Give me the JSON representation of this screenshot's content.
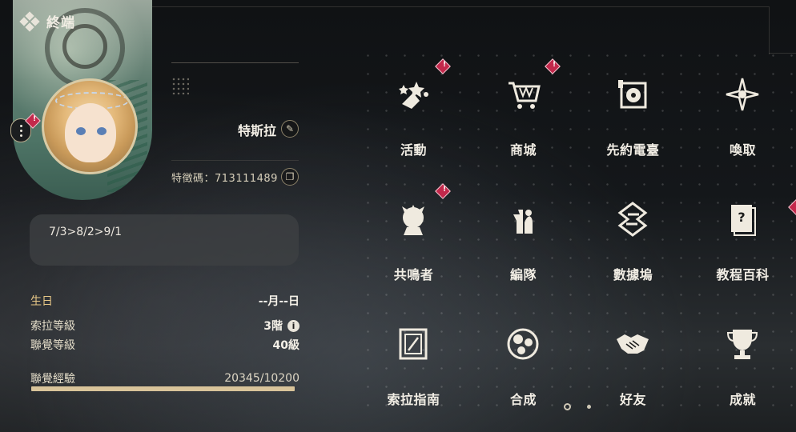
{
  "header": {
    "title": "終端"
  },
  "profile": {
    "name": "特斯拉",
    "uid_label": "特徵碼：",
    "uid": "713111489",
    "signature": "7/3>8/2>9/1"
  },
  "stats": {
    "birthday_label": "生日",
    "birthday_value": "--月--日",
    "sola_level_label": "索拉等級",
    "sola_level_value": "3階",
    "union_level_label": "聯覺等級",
    "union_level_value": "40級",
    "union_exp_label": "聯覺經驗",
    "union_exp_value": "20345/10200",
    "union_exp_progress": 1.0
  },
  "menu": {
    "items": [
      {
        "label": "活動",
        "icon": "event-stars-icon",
        "alert": true
      },
      {
        "label": "商城",
        "icon": "shopping-cart-icon",
        "alert": true
      },
      {
        "label": "先約電臺",
        "icon": "radio-record-icon",
        "alert": false
      },
      {
        "label": "喚取",
        "icon": "compass-star-icon",
        "alert": false
      },
      {
        "label": "共鳴者",
        "icon": "resonator-head-icon",
        "alert": true
      },
      {
        "label": "編隊",
        "icon": "chess-pieces-icon",
        "alert": false
      },
      {
        "label": "數據塢",
        "icon": "data-dock-icon",
        "alert": false
      },
      {
        "label": "教程百科",
        "icon": "tutorial-book-icon",
        "alert": true
      },
      {
        "label": "索拉指南",
        "icon": "guide-book-icon",
        "alert": false
      },
      {
        "label": "合成",
        "icon": "synthesis-orb-icon",
        "alert": false
      },
      {
        "label": "好友",
        "icon": "handshake-icon",
        "alert": false
      },
      {
        "label": "成就",
        "icon": "trophy-icon",
        "alert": false
      }
    ]
  },
  "pager": {
    "pages": 2,
    "current": 1
  },
  "colors": {
    "accent": "#d9c49a",
    "alert": "#c3284b",
    "label_accent": "#e8c887"
  }
}
